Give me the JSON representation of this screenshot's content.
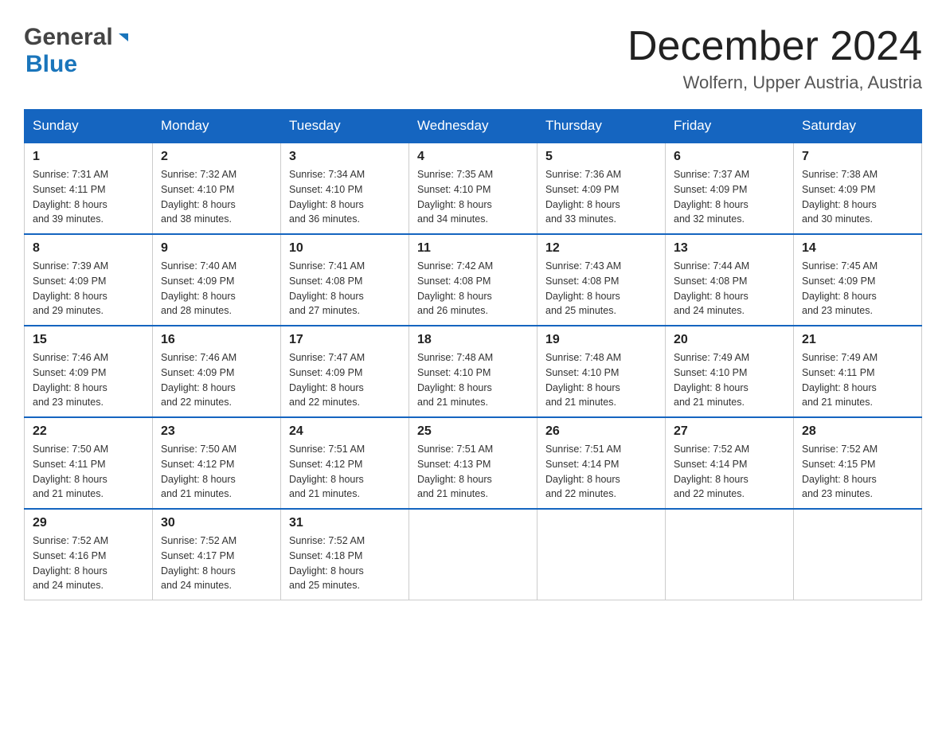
{
  "logo": {
    "general": "General",
    "blue": "Blue"
  },
  "title": {
    "month": "December 2024",
    "location": "Wolfern, Upper Austria, Austria"
  },
  "headers": [
    "Sunday",
    "Monday",
    "Tuesday",
    "Wednesday",
    "Thursday",
    "Friday",
    "Saturday"
  ],
  "weeks": [
    [
      {
        "day": "1",
        "sunrise": "Sunrise: 7:31 AM",
        "sunset": "Sunset: 4:11 PM",
        "daylight": "Daylight: 8 hours",
        "minutes": "and 39 minutes."
      },
      {
        "day": "2",
        "sunrise": "Sunrise: 7:32 AM",
        "sunset": "Sunset: 4:10 PM",
        "daylight": "Daylight: 8 hours",
        "minutes": "and 38 minutes."
      },
      {
        "day": "3",
        "sunrise": "Sunrise: 7:34 AM",
        "sunset": "Sunset: 4:10 PM",
        "daylight": "Daylight: 8 hours",
        "minutes": "and 36 minutes."
      },
      {
        "day": "4",
        "sunrise": "Sunrise: 7:35 AM",
        "sunset": "Sunset: 4:10 PM",
        "daylight": "Daylight: 8 hours",
        "minutes": "and 34 minutes."
      },
      {
        "day": "5",
        "sunrise": "Sunrise: 7:36 AM",
        "sunset": "Sunset: 4:09 PM",
        "daylight": "Daylight: 8 hours",
        "minutes": "and 33 minutes."
      },
      {
        "day": "6",
        "sunrise": "Sunrise: 7:37 AM",
        "sunset": "Sunset: 4:09 PM",
        "daylight": "Daylight: 8 hours",
        "minutes": "and 32 minutes."
      },
      {
        "day": "7",
        "sunrise": "Sunrise: 7:38 AM",
        "sunset": "Sunset: 4:09 PM",
        "daylight": "Daylight: 8 hours",
        "minutes": "and 30 minutes."
      }
    ],
    [
      {
        "day": "8",
        "sunrise": "Sunrise: 7:39 AM",
        "sunset": "Sunset: 4:09 PM",
        "daylight": "Daylight: 8 hours",
        "minutes": "and 29 minutes."
      },
      {
        "day": "9",
        "sunrise": "Sunrise: 7:40 AM",
        "sunset": "Sunset: 4:09 PM",
        "daylight": "Daylight: 8 hours",
        "minutes": "and 28 minutes."
      },
      {
        "day": "10",
        "sunrise": "Sunrise: 7:41 AM",
        "sunset": "Sunset: 4:08 PM",
        "daylight": "Daylight: 8 hours",
        "minutes": "and 27 minutes."
      },
      {
        "day": "11",
        "sunrise": "Sunrise: 7:42 AM",
        "sunset": "Sunset: 4:08 PM",
        "daylight": "Daylight: 8 hours",
        "minutes": "and 26 minutes."
      },
      {
        "day": "12",
        "sunrise": "Sunrise: 7:43 AM",
        "sunset": "Sunset: 4:08 PM",
        "daylight": "Daylight: 8 hours",
        "minutes": "and 25 minutes."
      },
      {
        "day": "13",
        "sunrise": "Sunrise: 7:44 AM",
        "sunset": "Sunset: 4:08 PM",
        "daylight": "Daylight: 8 hours",
        "minutes": "and 24 minutes."
      },
      {
        "day": "14",
        "sunrise": "Sunrise: 7:45 AM",
        "sunset": "Sunset: 4:09 PM",
        "daylight": "Daylight: 8 hours",
        "minutes": "and 23 minutes."
      }
    ],
    [
      {
        "day": "15",
        "sunrise": "Sunrise: 7:46 AM",
        "sunset": "Sunset: 4:09 PM",
        "daylight": "Daylight: 8 hours",
        "minutes": "and 23 minutes."
      },
      {
        "day": "16",
        "sunrise": "Sunrise: 7:46 AM",
        "sunset": "Sunset: 4:09 PM",
        "daylight": "Daylight: 8 hours",
        "minutes": "and 22 minutes."
      },
      {
        "day": "17",
        "sunrise": "Sunrise: 7:47 AM",
        "sunset": "Sunset: 4:09 PM",
        "daylight": "Daylight: 8 hours",
        "minutes": "and 22 minutes."
      },
      {
        "day": "18",
        "sunrise": "Sunrise: 7:48 AM",
        "sunset": "Sunset: 4:10 PM",
        "daylight": "Daylight: 8 hours",
        "minutes": "and 21 minutes."
      },
      {
        "day": "19",
        "sunrise": "Sunrise: 7:48 AM",
        "sunset": "Sunset: 4:10 PM",
        "daylight": "Daylight: 8 hours",
        "minutes": "and 21 minutes."
      },
      {
        "day": "20",
        "sunrise": "Sunrise: 7:49 AM",
        "sunset": "Sunset: 4:10 PM",
        "daylight": "Daylight: 8 hours",
        "minutes": "and 21 minutes."
      },
      {
        "day": "21",
        "sunrise": "Sunrise: 7:49 AM",
        "sunset": "Sunset: 4:11 PM",
        "daylight": "Daylight: 8 hours",
        "minutes": "and 21 minutes."
      }
    ],
    [
      {
        "day": "22",
        "sunrise": "Sunrise: 7:50 AM",
        "sunset": "Sunset: 4:11 PM",
        "daylight": "Daylight: 8 hours",
        "minutes": "and 21 minutes."
      },
      {
        "day": "23",
        "sunrise": "Sunrise: 7:50 AM",
        "sunset": "Sunset: 4:12 PM",
        "daylight": "Daylight: 8 hours",
        "minutes": "and 21 minutes."
      },
      {
        "day": "24",
        "sunrise": "Sunrise: 7:51 AM",
        "sunset": "Sunset: 4:12 PM",
        "daylight": "Daylight: 8 hours",
        "minutes": "and 21 minutes."
      },
      {
        "day": "25",
        "sunrise": "Sunrise: 7:51 AM",
        "sunset": "Sunset: 4:13 PM",
        "daylight": "Daylight: 8 hours",
        "minutes": "and 21 minutes."
      },
      {
        "day": "26",
        "sunrise": "Sunrise: 7:51 AM",
        "sunset": "Sunset: 4:14 PM",
        "daylight": "Daylight: 8 hours",
        "minutes": "and 22 minutes."
      },
      {
        "day": "27",
        "sunrise": "Sunrise: 7:52 AM",
        "sunset": "Sunset: 4:14 PM",
        "daylight": "Daylight: 8 hours",
        "minutes": "and 22 minutes."
      },
      {
        "day": "28",
        "sunrise": "Sunrise: 7:52 AM",
        "sunset": "Sunset: 4:15 PM",
        "daylight": "Daylight: 8 hours",
        "minutes": "and 23 minutes."
      }
    ],
    [
      {
        "day": "29",
        "sunrise": "Sunrise: 7:52 AM",
        "sunset": "Sunset: 4:16 PM",
        "daylight": "Daylight: 8 hours",
        "minutes": "and 24 minutes."
      },
      {
        "day": "30",
        "sunrise": "Sunrise: 7:52 AM",
        "sunset": "Sunset: 4:17 PM",
        "daylight": "Daylight: 8 hours",
        "minutes": "and 24 minutes."
      },
      {
        "day": "31",
        "sunrise": "Sunrise: 7:52 AM",
        "sunset": "Sunset: 4:18 PM",
        "daylight": "Daylight: 8 hours",
        "minutes": "and 25 minutes."
      },
      {
        "day": "",
        "sunrise": "",
        "sunset": "",
        "daylight": "",
        "minutes": ""
      },
      {
        "day": "",
        "sunrise": "",
        "sunset": "",
        "daylight": "",
        "minutes": ""
      },
      {
        "day": "",
        "sunrise": "",
        "sunset": "",
        "daylight": "",
        "minutes": ""
      },
      {
        "day": "",
        "sunrise": "",
        "sunset": "",
        "daylight": "",
        "minutes": ""
      }
    ]
  ]
}
